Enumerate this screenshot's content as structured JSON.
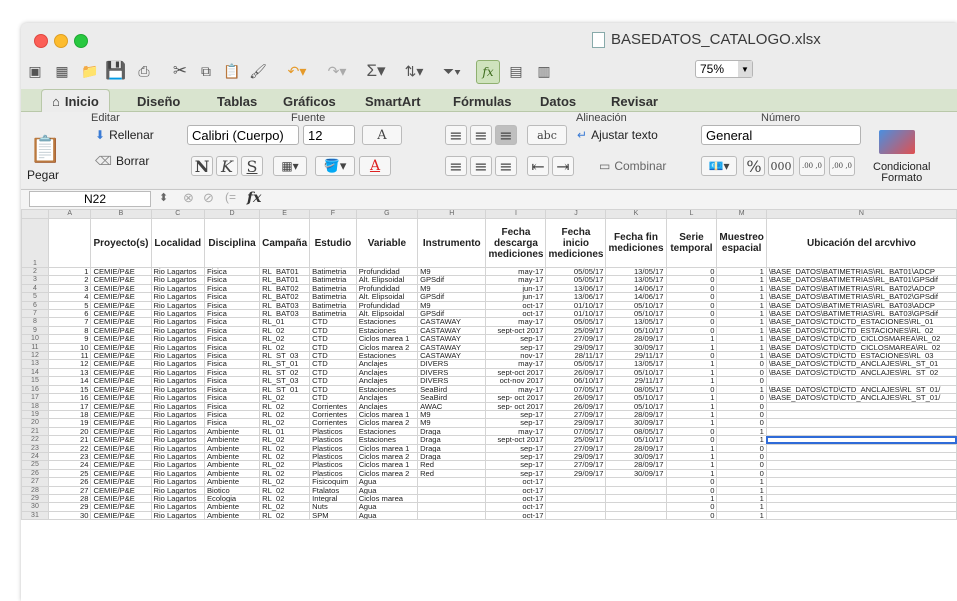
{
  "window": {
    "title": "BASEDATOS_CATALOGO.xlsx",
    "zoom": "75%"
  },
  "tabs": [
    {
      "label": "Inicio",
      "icon": "home-icon"
    },
    {
      "label": "Diseño"
    },
    {
      "label": "Tablas"
    },
    {
      "label": "Gráficos"
    },
    {
      "label": "SmartArt"
    },
    {
      "label": "Fórmulas"
    },
    {
      "label": "Datos"
    },
    {
      "label": "Revisar"
    }
  ],
  "ribbon": {
    "groups": {
      "editar": "Editar",
      "fuente": "Fuente",
      "alineacion": "Alineación",
      "numero": "Número"
    },
    "pegar": "Pegar",
    "rellenar": "Rellenar",
    "borrar": "Borrar",
    "font_name": "Calibri (Cuerpo)",
    "font_size": "12",
    "ajustar": "Ajustar texto",
    "combinar": "Combinar",
    "number_format": "General",
    "percent": "%",
    "thousands": "000",
    "dec_inc": ".00 ,0",
    "dec_dec": ",00 ,0",
    "condicional": "Condicional",
    "formato": "Formato",
    "abc": "abc",
    "bold": "N",
    "italic": "K",
    "underline": "S",
    "font_grow": "A",
    "font_color_letter": "A"
  },
  "formula_bar": {
    "name_box": "N22",
    "fx": "fx",
    "value": ""
  },
  "sheet": {
    "columns": [
      "A",
      "B",
      "C",
      "D",
      "E",
      "F",
      "G",
      "H",
      "I",
      "J",
      "K",
      "L",
      "M",
      "N"
    ],
    "header_row_num": "1",
    "headers": [
      "",
      "Proyecto(s)",
      "Localidad",
      "Disciplina",
      "Campaña",
      "Estudio",
      "Variable",
      "Instrumento",
      "Fecha descarga mediciones",
      "Fecha inicio mediciones",
      "Fecha fin mediciones",
      "Serie temporal",
      "Muestreo espacial",
      "Ubicación del arcvhivo"
    ],
    "rows": [
      [
        "2",
        "1",
        "CEMIE/P&E",
        "Rio Lagartos",
        "Fisica",
        "RL_BAT01",
        "Batimetria",
        "Profundidad",
        "M9",
        "may-17",
        "05/05/17",
        "13/05/17",
        "0",
        "1",
        "\\BASE_DATOS\\BATIMETRIAS\\RL_BAT01\\ADCP"
      ],
      [
        "3",
        "2",
        "CEMIE/P&E",
        "Rio Lagartos",
        "Fisica",
        "RL_BAT01",
        "Batimetria",
        "Alt. Elipsoidal",
        "GPSdif",
        "may-17",
        "05/05/17",
        "13/05/17",
        "0",
        "1",
        "\\BASE_DATOS\\BATIMETRIAS\\RL_BAT01\\GPSdif"
      ],
      [
        "4",
        "3",
        "CEMIE/P&E",
        "Rio Lagartos",
        "Fisica",
        "RL_BAT02",
        "Batimetria",
        "Profundidad",
        "M9",
        "jun-17",
        "13/06/17",
        "14/06/17",
        "0",
        "1",
        "\\BASE_DATOS\\BATIMETRIAS\\RL_BAT02\\ADCP"
      ],
      [
        "5",
        "4",
        "CEMIE/P&E",
        "Rio Lagartos",
        "Fisica",
        "RL_BAT02",
        "Batimetria",
        "Alt. Elipsoidal",
        "GPSdif",
        "jun-17",
        "13/06/17",
        "14/06/17",
        "0",
        "1",
        "\\BASE_DATOS\\BATIMETRIAS\\RL_BAT02\\GPSdif"
      ],
      [
        "6",
        "5",
        "CEMIE/P&E",
        "Rio Lagartos",
        "Fisica",
        "RL_BAT03",
        "Batimetria",
        "Profundidad",
        "M9",
        "oct-17",
        "01/10/17",
        "05/10/17",
        "0",
        "1",
        "\\BASE_DATOS\\BATIMETRIAS\\RL_BAT03\\ADCP"
      ],
      [
        "7",
        "6",
        "CEMIE/P&E",
        "Rio Lagartos",
        "Fisica",
        "RL_BAT03",
        "Batimetria",
        "Alt. Elipsoidal",
        "GPSdif",
        "oct-17",
        "01/10/17",
        "05/10/17",
        "0",
        "1",
        "\\BASE_DATOS\\BATIMETRIAS\\RL_BAT03\\GPSdif"
      ],
      [
        "8",
        "7",
        "CEMIE/P&E",
        "Rio Lagartos",
        "Fisica",
        "RL_01",
        "CTD",
        "Estaciones",
        "CASTAWAY",
        "may-17",
        "05/05/17",
        "13/05/17",
        "0",
        "1",
        "\\BASE_DATOS\\CTD\\CTD_ESTACIONES\\RL_01"
      ],
      [
        "9",
        "8",
        "CEMIE/P&E",
        "Rio Lagartos",
        "Fisica",
        "RL_02",
        "CTD",
        "Estaciones",
        "CASTAWAY",
        "sept-oct 2017",
        "25/09/17",
        "05/10/17",
        "0",
        "1",
        "\\BASE_DATOS\\CTD\\CTD_ESTACIONES\\RL_02"
      ],
      [
        "10",
        "9",
        "CEMIE/P&E",
        "Rio Lagartos",
        "Fisica",
        "RL_02",
        "CTD",
        "Ciclos marea 1",
        "CASTAWAY",
        "sep-17",
        "27/09/17",
        "28/09/17",
        "1",
        "1",
        "\\BASE_DATOS\\CTD\\CTD_CICLOSMAREA\\RL_02"
      ],
      [
        "11",
        "10",
        "CEMIE/P&E",
        "Rio Lagartos",
        "Fisica",
        "RL_02",
        "CTD",
        "Ciclos marea 2",
        "CASTAWAY",
        "sep-17",
        "29/09/17",
        "30/09/17",
        "1",
        "1",
        "\\BASE_DATOS\\CTD\\CTD_CICLOSMAREA\\RL_02"
      ],
      [
        "12",
        "11",
        "CEMIE/P&E",
        "Rio Lagartos",
        "Fisica",
        "RL_ST_03",
        "CTD",
        "Estaciones",
        "CASTAWAY",
        "nov-17",
        "28/11/17",
        "29/11/17",
        "0",
        "1",
        "\\BASE_DATOS\\CTD\\CTD_ESTACIONES\\RL_03"
      ],
      [
        "13",
        "12",
        "CEMIE/P&E",
        "Rio Lagartos",
        "Fisica",
        "RL_ST_01",
        "CTD",
        "Anclajes",
        "DIVERS",
        "may-17",
        "05/05/17",
        "13/05/17",
        "1",
        "0",
        "\\BASE_DATOS\\CTD\\CTD_ANCLAJES\\RL_ST_01"
      ],
      [
        "14",
        "13",
        "CEMIE/P&E",
        "Rio Lagartos",
        "Fisica",
        "RL_ST_02",
        "CTD",
        "Anclajes",
        "DIVERS",
        "sept-oct 2017",
        "26/09/17",
        "05/10/17",
        "1",
        "0",
        "\\BASE_DATOS\\CTD\\CTD_ANCLAJES\\RL_ST_02"
      ],
      [
        "15",
        "14",
        "CEMIE/P&E",
        "Rio Lagartos",
        "Fisica",
        "RL_ST_03",
        "CTD",
        "Anclajes",
        "DIVERS",
        "oct-nov 2017",
        "06/10/17",
        "29/11/17",
        "1",
        "0",
        ""
      ],
      [
        "16",
        "15",
        "CEMIE/P&E",
        "Rio Lagartos",
        "Fisica",
        "RL_ST_01",
        "CTD",
        "Estaciones",
        "SeaBird",
        "may-17",
        "07/05/17",
        "08/05/17",
        "0",
        "1",
        "\\BASE_DATOS\\CTD\\CTD_ANCLAJES\\RL_ST_01/"
      ],
      [
        "17",
        "16",
        "CEMIE/P&E",
        "Rio Lagartos",
        "Fisica",
        "RL_02",
        "CTD",
        "Anclajes",
        "SeaBird",
        "sep- oct 2017",
        "26/09/17",
        "05/10/17",
        "1",
        "0",
        "\\BASE_DATOS\\CTD\\CTD_ANCLAJES\\RL_ST_01/"
      ],
      [
        "18",
        "17",
        "CEMIE/P&E",
        "Rio Lagartos",
        "Fisica",
        "RL_02",
        "Corrientes",
        "Anclajes",
        "AWAC",
        "sep- oct 2017",
        "26/09/17",
        "05/10/17",
        "1",
        "0",
        ""
      ],
      [
        "19",
        "18",
        "CEMIE/P&E",
        "Rio Lagartos",
        "Fisica",
        "RL_02",
        "Corrientes",
        "Ciclos marea 1",
        "M9",
        "sep-17",
        "27/09/17",
        "28/09/17",
        "1",
        "0",
        ""
      ],
      [
        "20",
        "19",
        "CEMIE/P&E",
        "Rio Lagartos",
        "Fisica",
        "RL_02",
        "Corrientes",
        "Ciclos marea 2",
        "M9",
        "sep-17",
        "29/09/17",
        "30/09/17",
        "1",
        "0",
        ""
      ],
      [
        "21",
        "20",
        "CEMIE/P&E",
        "Rio Lagartos",
        "Ambiente",
        "RL_01",
        "Plasticos",
        "Estaciones",
        "Draga",
        "may-17",
        "07/05/17",
        "08/05/17",
        "0",
        "1",
        ""
      ],
      [
        "22",
        "21",
        "CEMIE/P&E",
        "Rio Lagartos",
        "Ambiente",
        "RL_02",
        "Plasticos",
        "Estaciones",
        "Draga",
        "sept-oct 2017",
        "25/09/17",
        "05/10/17",
        "0",
        "1",
        ""
      ],
      [
        "23",
        "22",
        "CEMIE/P&E",
        "Rio Lagartos",
        "Ambiente",
        "RL_02",
        "Plasticos",
        "Ciclos marea 1",
        "Draga",
        "sep-17",
        "27/09/17",
        "28/09/17",
        "1",
        "0",
        ""
      ],
      [
        "24",
        "23",
        "CEMIE/P&E",
        "Rio Lagartos",
        "Ambiente",
        "RL_02",
        "Plasticos",
        "Ciclos marea 2",
        "Draga",
        "sep-17",
        "29/09/17",
        "30/09/17",
        "1",
        "0",
        ""
      ],
      [
        "25",
        "24",
        "CEMIE/P&E",
        "Rio Lagartos",
        "Ambiente",
        "RL_02",
        "Plasticos",
        "Ciclos marea 1",
        "Red",
        "sep-17",
        "27/09/17",
        "28/09/17",
        "1",
        "0",
        ""
      ],
      [
        "26",
        "25",
        "CEMIE/P&E",
        "Rio Lagartos",
        "Ambiente",
        "RL_02",
        "Plasticos",
        "Ciclos marea 2",
        "Red",
        "sep-17",
        "29/09/17",
        "30/09/17",
        "1",
        "0",
        ""
      ],
      [
        "27",
        "26",
        "CEMIE/P&E",
        "Rio Lagartos",
        "Ambiente",
        "RL_02",
        "Fisicoquim",
        "Agua",
        "",
        "oct-17",
        "",
        "",
        "0",
        "1",
        ""
      ],
      [
        "28",
        "27",
        "CEMIE/P&E",
        "Rio Lagartos",
        "Biotico",
        "RL_02",
        "Ftalatos",
        "Agua",
        "",
        "oct-17",
        "",
        "",
        "0",
        "1",
        ""
      ],
      [
        "29",
        "28",
        "CEMIE/P&E",
        "Rio Lagartos",
        "Ecologia",
        "RL_02",
        "Integral",
        "Ciclos marea",
        "",
        "oct-17",
        "",
        "",
        "1",
        "1",
        ""
      ],
      [
        "30",
        "29",
        "CEMIE/P&E",
        "Rio Lagartos",
        "Ambiente",
        "RL_02",
        "Nuts",
        "Agua",
        "",
        "oct-17",
        "",
        "",
        "0",
        "1",
        ""
      ],
      [
        "31",
        "30",
        "CEMIE/P&E",
        "Rio Lagartos",
        "Ambiente",
        "RL_02",
        "SPM",
        "Agua",
        "",
        "oct-17",
        "",
        "",
        "0",
        "1",
        ""
      ]
    ],
    "selected_row": "22"
  }
}
